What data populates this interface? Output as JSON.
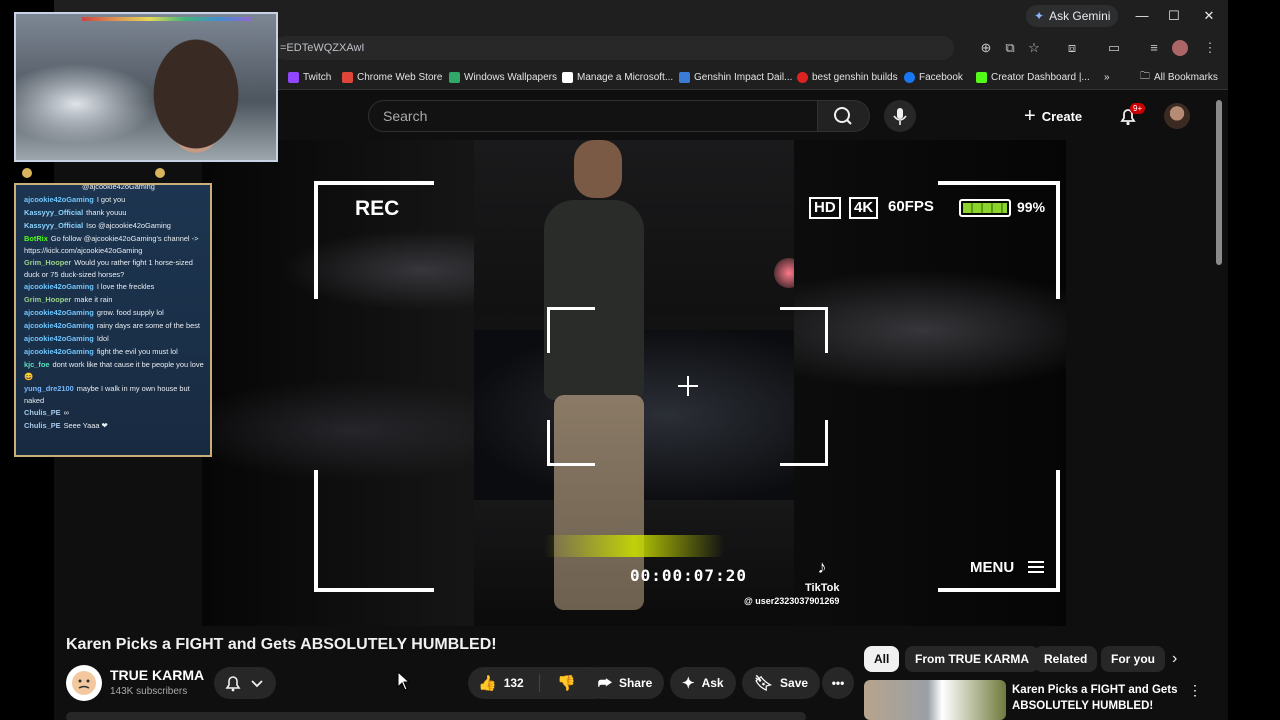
{
  "browser": {
    "ask_gemini": "Ask Gemini",
    "url": "=EDTeWQZXAwI",
    "bookmarks": [
      "Twitch",
      "Chrome Web Store",
      "Windows Wallpapers",
      "Manage a Microsoft...",
      "Genshin Impact Dail...",
      "best genshin builds",
      "Facebook",
      "Creator Dashboard |..."
    ],
    "overflow": "»",
    "all_bookmarks": "All Bookmarks",
    "colors": {
      "twitch": "#9146ff",
      "chrome_store": "#e0453a",
      "wallpapers": "#2fa86a",
      "facebook": "#1877f2",
      "kick": "#53fc18"
    }
  },
  "youtube": {
    "search_placeholder": "Search",
    "create_label": "Create",
    "notif_badge": "9+"
  },
  "player": {
    "rec": "REC",
    "hd": "HD",
    "k4": "4K",
    "fps": "60FPS",
    "battery_level": 0.99,
    "battery_pct": "99%",
    "timecode": "00:00:07:20",
    "tiktok": "TikTok",
    "tiktok_user": "@ user2323037901269",
    "menu": "MENU"
  },
  "video": {
    "title": "Karen Picks a FIGHT and Gets ABSOLUTELY HUMBLED!",
    "channel": "TRUE KARMA",
    "subscribers": "143K subscribers",
    "likes": "132",
    "share": "Share",
    "ask": "Ask",
    "save": "Save"
  },
  "sidebar": {
    "chips": [
      "All",
      "From TRUE KARMA",
      "Related",
      "For you"
    ],
    "rec_title": "Karen Picks a FIGHT and Gets ABSOLUTELY HUMBLED!"
  },
  "chat": [
    {
      "user": "",
      "text": "@ajcookie42oGaming",
      "cls": "cu-a"
    },
    {
      "user": "ajcookie42oGaming",
      "text": "I got you",
      "cls": "cu-a"
    },
    {
      "user": "Kassyyy_Official",
      "text": "thank youuu",
      "cls": "cu-k"
    },
    {
      "user": "Kassyyy_Official",
      "text": "Iso @ajcookie42oGaming",
      "cls": "cu-k"
    },
    {
      "user": "BotRix",
      "text": "Go follow @ajcookie42oGaming's channel -> https://kick.com/ajcookie42oGaming",
      "cls": "cu-b"
    },
    {
      "user": "Grim_Hooper",
      "text": "Would you rather fight 1 horse-sized duck or 75 duck-sized horses?",
      "cls": "cu-g"
    },
    {
      "user": "ajcookie42oGaming",
      "text": "I love the freckles",
      "cls": "cu-a"
    },
    {
      "user": "Grim_Hooper",
      "text": "make it rain",
      "cls": "cu-g"
    },
    {
      "user": "ajcookie42oGaming",
      "text": "grow. food supply lol",
      "cls": "cu-a"
    },
    {
      "user": "ajcookie42oGaming",
      "text": "rainy days are some of the best",
      "cls": "cu-a"
    },
    {
      "user": "ajcookie42oGaming",
      "text": "Idol",
      "cls": "cu-a"
    },
    {
      "user": "ajcookie42oGaming",
      "text": "fight the evil you must lol",
      "cls": "cu-a"
    },
    {
      "user": "kjc_foe",
      "text": "dont work like that cause it be people you love 😄",
      "cls": "cu-j"
    },
    {
      "user": "yung_dre2100",
      "text": "maybe I walk in my own house but naked",
      "cls": "cu-y"
    },
    {
      "user": "Chulis_PE",
      "text": "∞",
      "cls": "cu-c"
    },
    {
      "user": "Chulis_PE",
      "text": "Seee Yaaa ❤",
      "cls": "cu-c"
    }
  ]
}
